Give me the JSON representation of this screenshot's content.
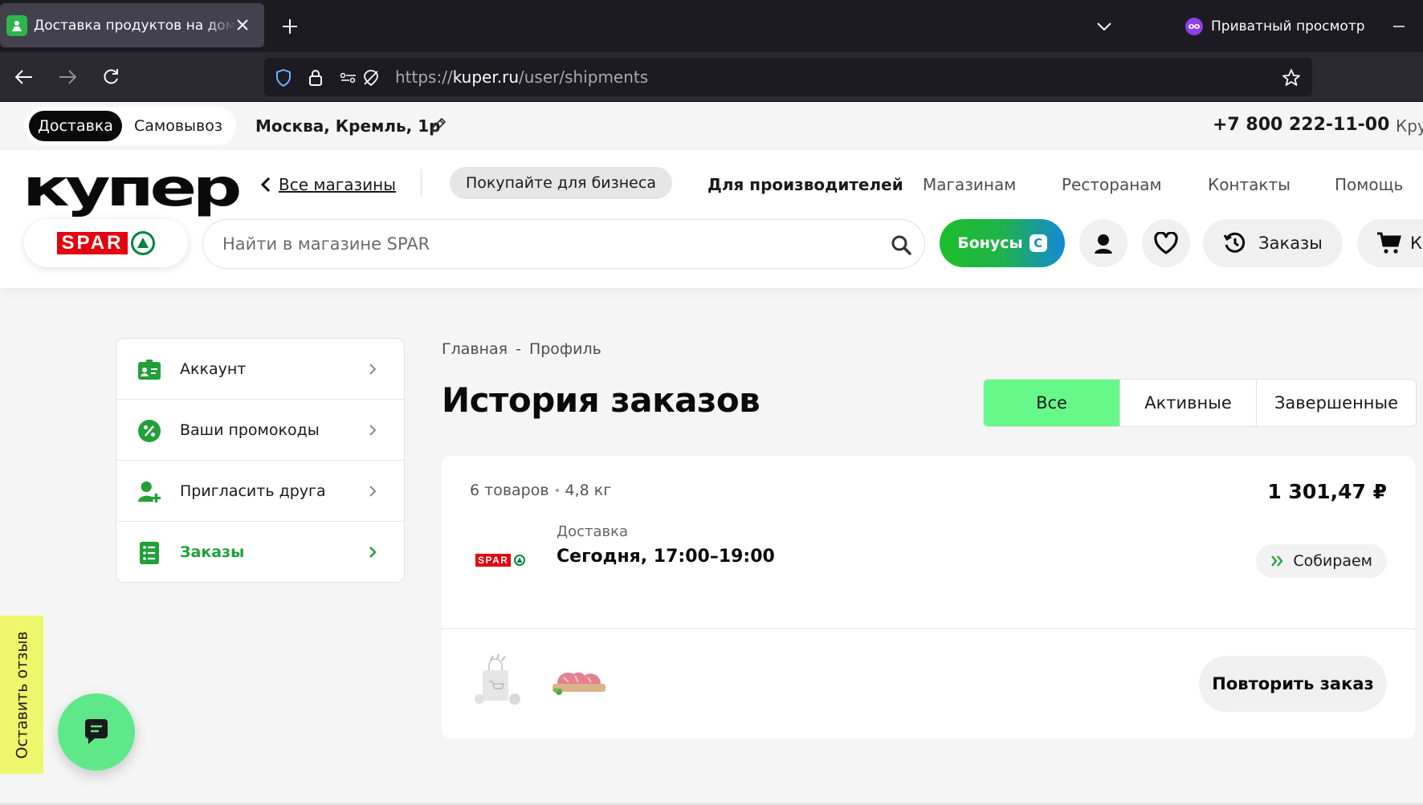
{
  "browser": {
    "tab_title": "Доставка продуктов на дом, ед",
    "private_label": "Приватный просмотр",
    "url_prefix": "https://",
    "url_domain": "kuper.ru",
    "url_path": "/user/shipments"
  },
  "topstrip": {
    "mode_delivery": "Доставка",
    "mode_pickup": "Самовывоз",
    "address": "Москва, Кремль, 1р",
    "phone": "+7 800 222-11-00",
    "phone_extra": "Кру"
  },
  "header": {
    "logo": "купер",
    "all_stores": "Все магазины",
    "business_btn": "Покупайте для бизнеса",
    "links": {
      "producers": "Для производителей",
      "shops": "Магазинам",
      "restaurants": "Ресторанам",
      "contacts": "Контакты",
      "help": "Помощь"
    },
    "store_logo": "SPAR",
    "search_placeholder": "Найти в магазине SPAR",
    "bonus_label": "Бонусы",
    "bonus_badge": "С",
    "orders_label": "Заказы",
    "cart_label": "К"
  },
  "sidebar": {
    "items": [
      {
        "label": "Аккаунт",
        "icon": "account-card-icon",
        "active": false
      },
      {
        "label": "Ваши промокоды",
        "icon": "percent-icon",
        "active": false
      },
      {
        "label": "Пригласить друга",
        "icon": "invite-user-icon",
        "active": false
      },
      {
        "label": "Заказы",
        "icon": "orders-list-icon",
        "active": true
      }
    ]
  },
  "main": {
    "breadcrumb": {
      "home": "Главная",
      "separator": "-",
      "profile": "Профиль"
    },
    "title": "История заказов",
    "filters": {
      "all": "Все",
      "active": "Активные",
      "completed": "Завершенные"
    },
    "order": {
      "items_count": "6 товаров",
      "weight": "4,8 кг",
      "price": "1 301,47 ₽",
      "delivery_label": "Доставка",
      "delivery_time": "Сегодня, 17:00–19:00",
      "status": "Собираем",
      "store": "SPAR",
      "repeat_btn": "Повторить заказ"
    }
  },
  "feedback": {
    "label": "Оставить отзыв"
  },
  "colors": {
    "accent_green": "#21a038",
    "active_tab_green": "#66f98a",
    "spar_red": "#e3000f",
    "feedback_yellow": "#eef76b",
    "chat_green": "#5ee88a"
  }
}
